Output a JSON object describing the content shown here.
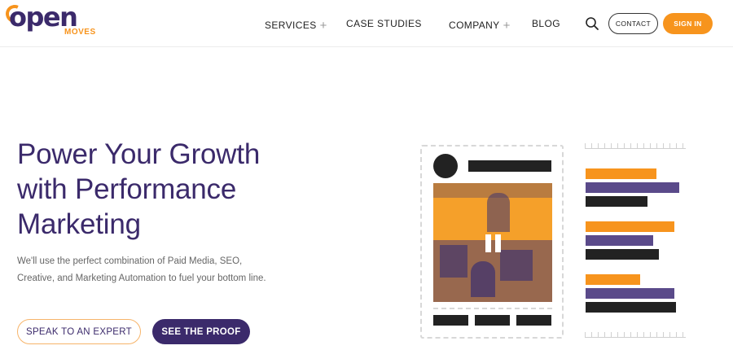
{
  "brand": {
    "logo_main": "open",
    "logo_sub": "MOVES",
    "accent": "#f7941d",
    "primary": "#3b2a6b"
  },
  "nav": {
    "items": [
      {
        "label": "SERVICES",
        "has_plus": true
      },
      {
        "label": "CASE STUDIES",
        "has_plus": false
      },
      {
        "label": "COMPANY",
        "has_plus": true
      },
      {
        "label": "BLOG",
        "has_plus": false
      }
    ],
    "plus_symbol": "+",
    "search_icon": "search-icon",
    "contact_label": "CONTACT",
    "signin_label": "SIGN IN"
  },
  "hero": {
    "title_line1": "Power Your Growth",
    "title_line2": "with Performance",
    "title_line3": "Marketing",
    "text_line1": "We'll use the perfect combination of Paid Media, SEO,",
    "text_line2": "Creative, and Marketing Automation to fuel your bottom line.",
    "cta_primary": "SPEAK TO AN EXPERT",
    "cta_secondary": "SEE THE PROOF"
  },
  "illustration": {
    "video_icon": "pause-icon",
    "colors": {
      "orange": "#f7941d",
      "purple": "#5a4a8a",
      "dark": "#222222"
    },
    "bar_groups": [
      [
        {
          "color": "orange",
          "fraction": 0.71
        },
        {
          "color": "purple",
          "fraction": 0.94
        },
        {
          "color": "dark",
          "fraction": 0.62
        }
      ],
      [
        {
          "color": "orange",
          "fraction": 0.89
        },
        {
          "color": "purple",
          "fraction": 0.68
        },
        {
          "color": "dark",
          "fraction": 0.74
        }
      ],
      [
        {
          "color": "orange",
          "fraction": 0.55
        },
        {
          "color": "purple",
          "fraction": 0.89
        },
        {
          "color": "dark",
          "fraction": 0.91
        }
      ]
    ]
  }
}
